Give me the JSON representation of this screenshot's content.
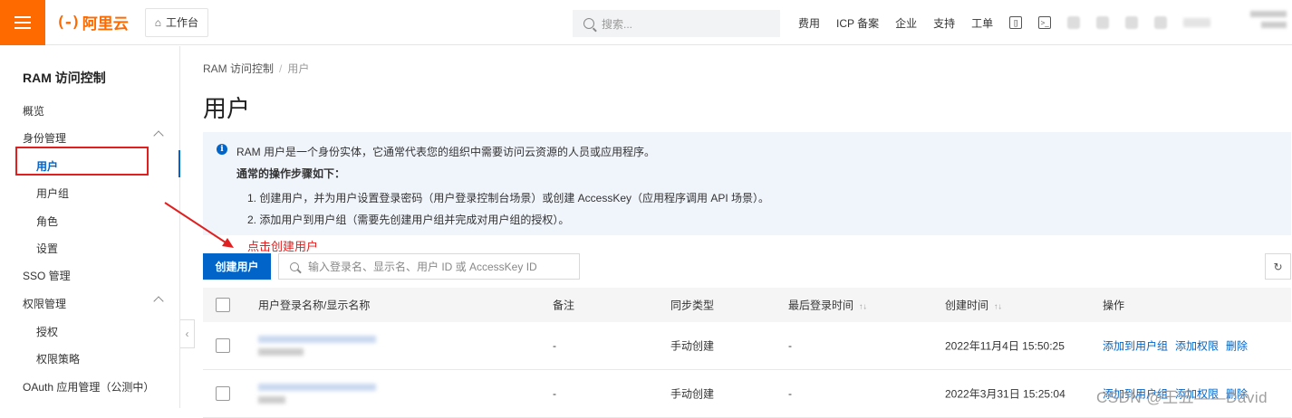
{
  "topbar": {
    "logo_text": "阿里云",
    "logo_mark": "(-)",
    "workbench_label": "工作台",
    "search_placeholder": "搜索...",
    "nav": [
      "费用",
      "ICP 备案",
      "企业",
      "支持",
      "工单"
    ]
  },
  "sidebar": {
    "title": "RAM 访问控制",
    "items": [
      {
        "label": "概览"
      },
      {
        "label": "身份管理"
      },
      {
        "label": "用户"
      },
      {
        "label": "用户组"
      },
      {
        "label": "角色"
      },
      {
        "label": "设置"
      },
      {
        "label": "SSO 管理"
      },
      {
        "label": "权限管理"
      },
      {
        "label": "授权"
      },
      {
        "label": "权限策略"
      },
      {
        "label": "OAuth 应用管理（公测中）"
      }
    ]
  },
  "breadcrumb": {
    "root": "RAM 访问控制",
    "sep": "/",
    "current": "用户"
  },
  "page_title": "用户",
  "info": {
    "line1": "RAM 用户是一个身份实体，它通常代表您的组织中需要访问云资源的人员或应用程序。",
    "line2": "通常的操作步骤如下：",
    "step1": "1. 创建用户，并为用户设置登录密码（用户登录控制台场景）或创建 AccessKey（应用程序调用 API 场景）。",
    "step2": "2. 添加用户到用户组（需要先创建用户组并完成对用户组的授权）。"
  },
  "annotation": "点击创建用户",
  "toolbar": {
    "create_label": "创建用户",
    "search_placeholder": "输入登录名、显示名、用户 ID 或 AccessKey ID",
    "refresh_icon": "↻"
  },
  "table": {
    "headers": {
      "name": "用户登录名称/显示名称",
      "note": "备注",
      "sync": "同步类型",
      "last_login": "最后登录时间",
      "created": "创建时间",
      "ops": "操作"
    },
    "rows": [
      {
        "note": "-",
        "sync": "手动创建",
        "last_login": "-",
        "created": "2022年11月4日 15:50:25",
        "ops": [
          "添加到用户组",
          "添加权限",
          "删除"
        ]
      },
      {
        "note": "-",
        "sync": "手动创建",
        "last_login": "-",
        "created": "2022年3月31日 15:25:04",
        "ops": [
          "添加到用户组",
          "添加权限",
          "删除"
        ]
      }
    ]
  },
  "watermark": "CSDN @王五——David"
}
